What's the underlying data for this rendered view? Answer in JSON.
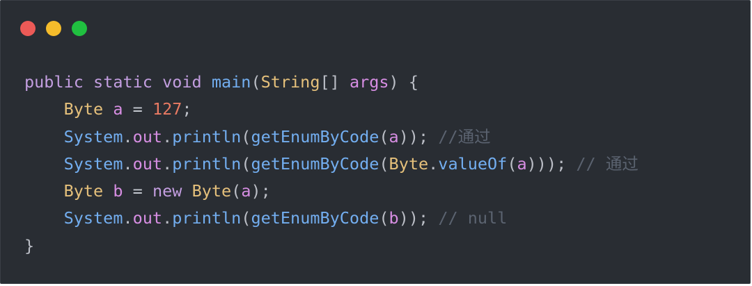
{
  "window": {
    "traffic_lights": [
      {
        "name": "close",
        "color": "#ec5a57"
      },
      {
        "name": "minimize",
        "color": "#f5bc2b"
      },
      {
        "name": "maximize",
        "color": "#20c040"
      }
    ]
  },
  "code": {
    "language": "java",
    "lines": [
      [
        {
          "t": "public",
          "k": "keyword"
        },
        {
          "t": " ",
          "k": "plain"
        },
        {
          "t": "static",
          "k": "keyword"
        },
        {
          "t": " ",
          "k": "plain"
        },
        {
          "t": "void",
          "k": "keyword"
        },
        {
          "t": " ",
          "k": "plain"
        },
        {
          "t": "main",
          "k": "func"
        },
        {
          "t": "(",
          "k": "punct"
        },
        {
          "t": "String",
          "k": "type"
        },
        {
          "t": "[]",
          "k": "punct"
        },
        {
          "t": " ",
          "k": "plain"
        },
        {
          "t": "args",
          "k": "var"
        },
        {
          "t": ") {",
          "k": "punct"
        }
      ],
      [
        {
          "t": "    ",
          "k": "plain"
        },
        {
          "t": "Byte",
          "k": "type"
        },
        {
          "t": " ",
          "k": "plain"
        },
        {
          "t": "a",
          "k": "var"
        },
        {
          "t": " ",
          "k": "plain"
        },
        {
          "t": "=",
          "k": "op"
        },
        {
          "t": " ",
          "k": "plain"
        },
        {
          "t": "127",
          "k": "number"
        },
        {
          "t": ";",
          "k": "punct"
        }
      ],
      [
        {
          "t": "    ",
          "k": "plain"
        },
        {
          "t": "System",
          "k": "func"
        },
        {
          "t": ".",
          "k": "punct"
        },
        {
          "t": "out",
          "k": "var"
        },
        {
          "t": ".",
          "k": "punct"
        },
        {
          "t": "println",
          "k": "func"
        },
        {
          "t": "(",
          "k": "punct"
        },
        {
          "t": "getEnumByCode",
          "k": "func"
        },
        {
          "t": "(",
          "k": "punct"
        },
        {
          "t": "a",
          "k": "var"
        },
        {
          "t": "));",
          "k": "punct"
        },
        {
          "t": " ",
          "k": "plain"
        },
        {
          "t": "//通过",
          "k": "comment"
        }
      ],
      [
        {
          "t": "    ",
          "k": "plain"
        },
        {
          "t": "System",
          "k": "func"
        },
        {
          "t": ".",
          "k": "punct"
        },
        {
          "t": "out",
          "k": "var"
        },
        {
          "t": ".",
          "k": "punct"
        },
        {
          "t": "println",
          "k": "func"
        },
        {
          "t": "(",
          "k": "punct"
        },
        {
          "t": "getEnumByCode",
          "k": "func"
        },
        {
          "t": "(",
          "k": "punct"
        },
        {
          "t": "Byte",
          "k": "type"
        },
        {
          "t": ".",
          "k": "punct"
        },
        {
          "t": "valueOf",
          "k": "func"
        },
        {
          "t": "(",
          "k": "punct"
        },
        {
          "t": "a",
          "k": "var"
        },
        {
          "t": ")));",
          "k": "punct"
        },
        {
          "t": " ",
          "k": "plain"
        },
        {
          "t": "// 通过",
          "k": "comment"
        }
      ],
      [
        {
          "t": "    ",
          "k": "plain"
        },
        {
          "t": "Byte",
          "k": "type"
        },
        {
          "t": " ",
          "k": "plain"
        },
        {
          "t": "b",
          "k": "var"
        },
        {
          "t": " ",
          "k": "plain"
        },
        {
          "t": "=",
          "k": "op"
        },
        {
          "t": " ",
          "k": "plain"
        },
        {
          "t": "new",
          "k": "keyword"
        },
        {
          "t": " ",
          "k": "plain"
        },
        {
          "t": "Byte",
          "k": "type"
        },
        {
          "t": "(",
          "k": "punct"
        },
        {
          "t": "a",
          "k": "var"
        },
        {
          "t": ");",
          "k": "punct"
        }
      ],
      [
        {
          "t": "    ",
          "k": "plain"
        },
        {
          "t": "System",
          "k": "func"
        },
        {
          "t": ".",
          "k": "punct"
        },
        {
          "t": "out",
          "k": "var"
        },
        {
          "t": ".",
          "k": "punct"
        },
        {
          "t": "println",
          "k": "func"
        },
        {
          "t": "(",
          "k": "punct"
        },
        {
          "t": "getEnumByCode",
          "k": "func"
        },
        {
          "t": "(",
          "k": "punct"
        },
        {
          "t": "b",
          "k": "var"
        },
        {
          "t": "));",
          "k": "punct"
        },
        {
          "t": " ",
          "k": "plain"
        },
        {
          "t": "// null",
          "k": "comment"
        }
      ],
      [
        {
          "t": "}",
          "k": "punct"
        }
      ]
    ]
  }
}
